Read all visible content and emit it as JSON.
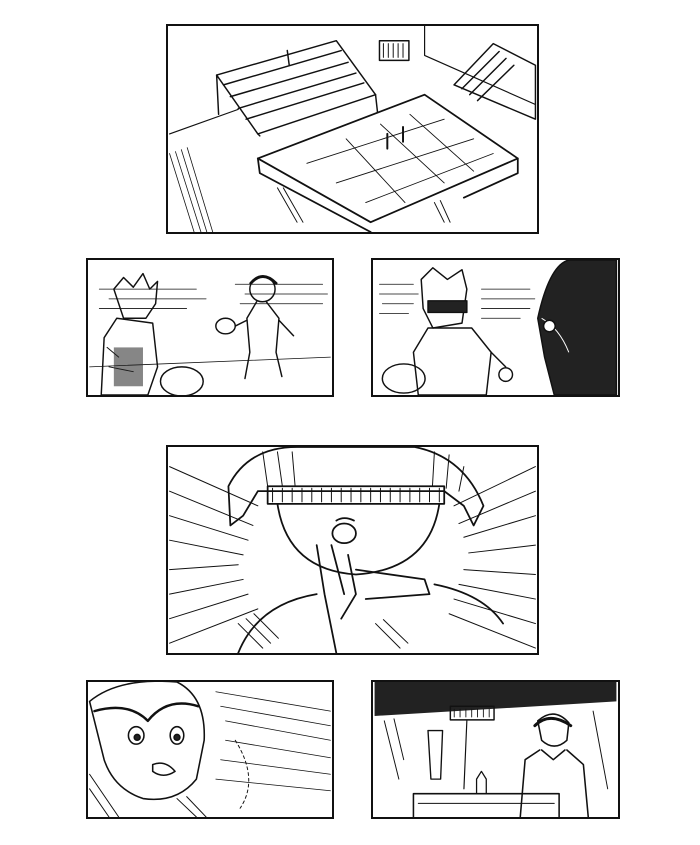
{
  "page": {
    "type": "comic-page",
    "background": "#ffffff",
    "ink_color": "#111111"
  },
  "panels": [
    {
      "scene": "gym-with-bleachers-and-ping-pong-table"
    },
    {
      "scene": "two-players-with-paddles"
    },
    {
      "scene": "player-with-visor-facing-opponent"
    },
    {
      "scene": "closeup-face-with-hand-gesture"
    },
    {
      "scene": "girl-looking-surprised-at-passing-ball"
    },
    {
      "scene": "man-standing-behind-counter"
    }
  ]
}
